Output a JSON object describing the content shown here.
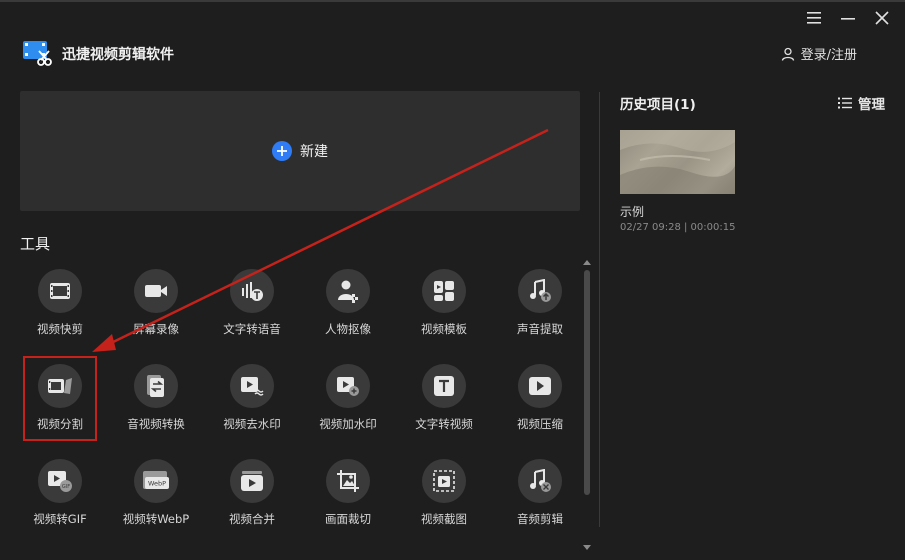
{
  "app": {
    "title": "迅捷视频剪辑软件"
  },
  "header": {
    "login_label": "登录/注册"
  },
  "new_project": {
    "label": "新建"
  },
  "tools": {
    "title": "工具",
    "items": [
      {
        "label": "视频快剪",
        "icon": "film-icon"
      },
      {
        "label": "屏幕录像",
        "icon": "camera-icon"
      },
      {
        "label": "文字转语音",
        "icon": "text-to-speech-icon"
      },
      {
        "label": "人物抠像",
        "icon": "person-cutout-icon"
      },
      {
        "label": "视频模板",
        "icon": "template-icon"
      },
      {
        "label": "声音提取",
        "icon": "audio-extract-icon"
      },
      {
        "label": "视频分割",
        "icon": "video-split-icon"
      },
      {
        "label": "音视频转换",
        "icon": "av-convert-icon"
      },
      {
        "label": "视频去水印",
        "icon": "remove-watermark-icon"
      },
      {
        "label": "视频加水印",
        "icon": "add-watermark-icon"
      },
      {
        "label": "文字转视频",
        "icon": "text-to-video-icon"
      },
      {
        "label": "视频压缩",
        "icon": "video-compress-icon"
      },
      {
        "label": "视频转GIF",
        "icon": "video-to-gif-icon"
      },
      {
        "label": "视频转WebP",
        "icon": "video-to-webp-icon"
      },
      {
        "label": "视频合并",
        "icon": "video-merge-icon"
      },
      {
        "label": "画面裁切",
        "icon": "crop-icon"
      },
      {
        "label": "视频截图",
        "icon": "screenshot-icon"
      },
      {
        "label": "音频剪辑",
        "icon": "audio-edit-icon"
      }
    ]
  },
  "history": {
    "title": "历史项目(1)",
    "manage_label": "管理",
    "items": [
      {
        "name": "示例",
        "meta": "02/27 09:28 | 00:00:15"
      }
    ]
  },
  "colors": {
    "accent": "#2f7cf6",
    "highlight": "#c4221b",
    "background": "#1e1e1e"
  }
}
